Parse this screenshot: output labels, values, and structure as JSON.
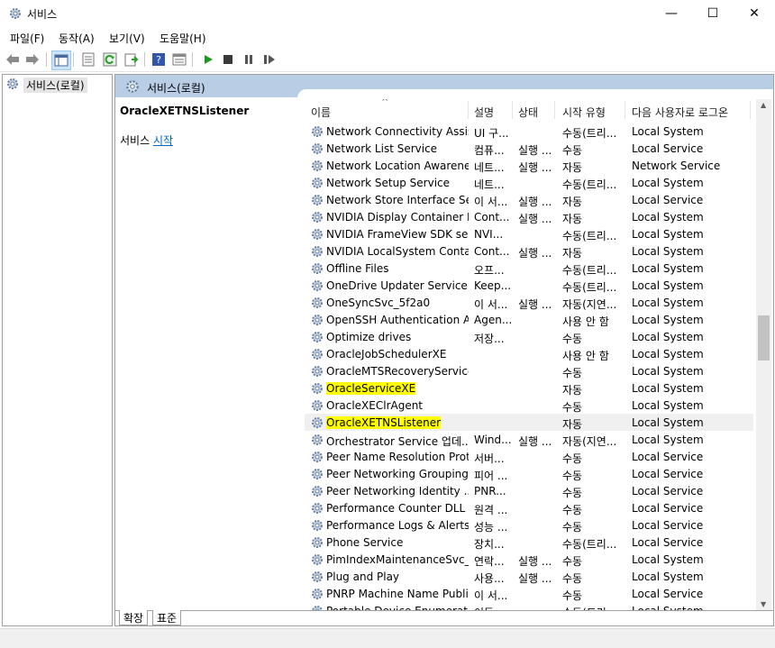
{
  "window": {
    "title": "서비스",
    "minimize": "—",
    "maximize": "☐",
    "close": "✕"
  },
  "menu": [
    "파일(F)",
    "동작(A)",
    "보기(V)",
    "도움말(H)"
  ],
  "tree": {
    "root": "서비스(로컬)"
  },
  "pane": {
    "title": "서비스(로컬)"
  },
  "description": {
    "service_name": "OracleXETNSListener",
    "action_prefix": "서비스 ",
    "action_link": "시작"
  },
  "columns": {
    "name": "이름",
    "description": "설명",
    "status": "상태",
    "startup": "시작 유형",
    "logon": "다음 사용자로 로그온"
  },
  "services": [
    {
      "name": "Network Connectivity Assis...",
      "desc": "UI 구...",
      "status": "",
      "startup": "수동(트리...",
      "logon": "Local System"
    },
    {
      "name": "Network List Service",
      "desc": "컴퓨...",
      "status": "실행 ...",
      "startup": "수동",
      "logon": "Local Service"
    },
    {
      "name": "Network Location Awareness",
      "desc": "네트...",
      "status": "실행 ...",
      "startup": "자동",
      "logon": "Network Service"
    },
    {
      "name": "Network Setup Service",
      "desc": "네트...",
      "status": "",
      "startup": "수동(트리...",
      "logon": "Local System"
    },
    {
      "name": "Network Store Interface Se...",
      "desc": "이 서...",
      "status": "실행 ...",
      "startup": "자동",
      "logon": "Local Service"
    },
    {
      "name": "NVIDIA Display Container LS",
      "desc": "Cont...",
      "status": "실행 ...",
      "startup": "자동",
      "logon": "Local System"
    },
    {
      "name": "NVIDIA FrameView SDK se...",
      "desc": "NVI...",
      "status": "",
      "startup": "수동(트리...",
      "logon": "Local System"
    },
    {
      "name": "NVIDIA LocalSystem Conta...",
      "desc": "Cont...",
      "status": "실행 ...",
      "startup": "자동",
      "logon": "Local System"
    },
    {
      "name": "Offline Files",
      "desc": "오프...",
      "status": "",
      "startup": "수동(트리...",
      "logon": "Local System"
    },
    {
      "name": "OneDrive Updater Service",
      "desc": "Keep...",
      "status": "",
      "startup": "수동(트리...",
      "logon": "Local System"
    },
    {
      "name": "OneSyncSvc_5f2a0",
      "desc": "이 서...",
      "status": "실행 ...",
      "startup": "자동(지연...",
      "logon": "Local System"
    },
    {
      "name": "OpenSSH Authentication A...",
      "desc": "Agen...",
      "status": "",
      "startup": "사용 안 함",
      "logon": "Local System"
    },
    {
      "name": "Optimize drives",
      "desc": "저장...",
      "status": "",
      "startup": "수동",
      "logon": "Local System"
    },
    {
      "name": "OracleJobSchedulerXE",
      "desc": "",
      "status": "",
      "startup": "사용 안 함",
      "logon": "Local System"
    },
    {
      "name": "OracleMTSRecoveryService",
      "desc": "",
      "status": "",
      "startup": "수동",
      "logon": "Local System"
    },
    {
      "name": "OracleServiceXE",
      "desc": "",
      "status": "",
      "startup": "자동",
      "logon": "Local System",
      "highlight": true
    },
    {
      "name": "OracleXEClrAgent",
      "desc": "",
      "status": "",
      "startup": "수동",
      "logon": "Local System"
    },
    {
      "name": "OracleXETNSListener",
      "desc": "",
      "status": "",
      "startup": "자동",
      "logon": "Local System",
      "highlight": true,
      "selected": true
    },
    {
      "name": "Orchestrator Service 업데...",
      "desc": "Wind...",
      "status": "실행 ...",
      "startup": "자동(지연...",
      "logon": "Local System"
    },
    {
      "name": "Peer Name Resolution Prot...",
      "desc": "서버...",
      "status": "",
      "startup": "수동",
      "logon": "Local Service"
    },
    {
      "name": "Peer Networking Grouping",
      "desc": "피어 ...",
      "status": "",
      "startup": "수동",
      "logon": "Local Service"
    },
    {
      "name": "Peer Networking Identity ...",
      "desc": "PNR...",
      "status": "",
      "startup": "수동",
      "logon": "Local Service"
    },
    {
      "name": "Performance Counter DLL ...",
      "desc": "원격 ...",
      "status": "",
      "startup": "수동",
      "logon": "Local Service"
    },
    {
      "name": "Performance Logs & Alerts",
      "desc": "성능 ...",
      "status": "",
      "startup": "수동",
      "logon": "Local Service"
    },
    {
      "name": "Phone Service",
      "desc": "장치...",
      "status": "",
      "startup": "수동(트리...",
      "logon": "Local Service"
    },
    {
      "name": "PimIndexMaintenanceSvc_...",
      "desc": "연락...",
      "status": "실행 ...",
      "startup": "수동",
      "logon": "Local System"
    },
    {
      "name": "Plug and Play",
      "desc": "사용...",
      "status": "실행 ...",
      "startup": "수동",
      "logon": "Local System"
    },
    {
      "name": "PNRP Machine Name Publi...",
      "desc": "이 서...",
      "status": "",
      "startup": "수동",
      "logon": "Local Service"
    },
    {
      "name": "Portable Device Enumerato...",
      "desc": "이동...",
      "status": "",
      "startup": "수동(트리...",
      "logon": "Local System"
    }
  ],
  "tabs": [
    "확장",
    "표준"
  ],
  "icons": [
    "services-gear-icon",
    "back-arrow-icon",
    "forward-arrow-icon",
    "console-tree-icon",
    "properties-icon",
    "refresh-icon",
    "export-icon",
    "help-icon",
    "mmc-view-icon",
    "start-service-icon",
    "stop-service-icon",
    "pause-service-icon",
    "resume-service-icon"
  ],
  "colors": {
    "pane_header": "#b9cde4",
    "highlight": "#ffff00",
    "link": "#0066cc",
    "tree_selected": "#e5e5e5"
  }
}
